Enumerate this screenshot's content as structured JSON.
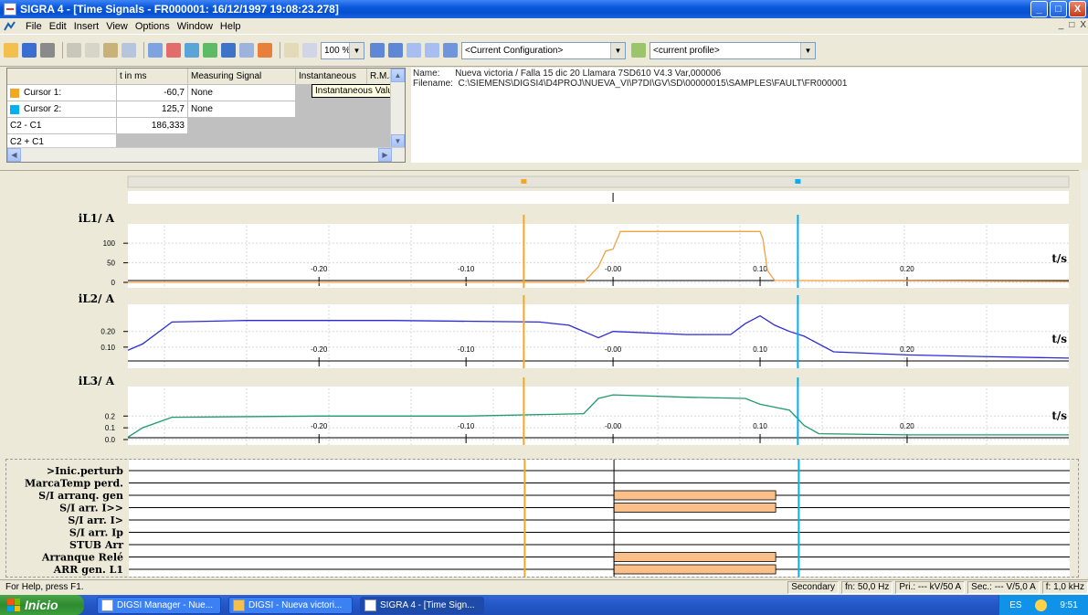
{
  "window": {
    "title": "SIGRA 4 - [Time Signals - FR000001: 16/12/1997 19:08:23.278]",
    "controls": [
      "_",
      "□",
      "X"
    ]
  },
  "menu": [
    "File",
    "Edit",
    "Insert",
    "View",
    "Options",
    "Window",
    "Help"
  ],
  "toolbar": {
    "zoom_value": "100 %",
    "configuration": "<Current Configuration>",
    "profile": "<current profile>"
  },
  "cursor_table": {
    "headers": [
      "",
      "t in ms",
      "Measuring Signal",
      "Instantaneous",
      "R.M.S"
    ],
    "rows": [
      {
        "label": "Cursor 1:",
        "swatch": "#f5a623",
        "t": "-60,7",
        "signal": "None"
      },
      {
        "label": "Cursor 2:",
        "swatch": "#00b0f0",
        "t": "125,7",
        "signal": "None"
      },
      {
        "label": "C2 - C1",
        "t": "186,333",
        "signal": ""
      },
      {
        "label": "C2 + C1",
        "t": "",
        "signal": ""
      }
    ],
    "tooltip": "Instantaneous Value"
  },
  "file_info": {
    "name_label": "Name:",
    "name_value": "Nueva victoria / Falla 15 dic 20  Llamara  7SD610 V4.3 Var,000006",
    "filename_label": "Filename:",
    "filename_value": "C:\\SIEMENS\\DIGSI4\\D4PROJ\\NUEVA_VI\\P7DI\\GV\\SD\\00000015\\SAMPLES\\FAULT\\FR000001"
  },
  "chart_data": [
    {
      "type": "line",
      "title": "iL1/ A",
      "color": "#f5a142",
      "x_ticks": [
        "-0.20",
        "-0.10",
        "-0.00",
        "0.10",
        "0.20"
      ],
      "y_ticks": [
        "100",
        "50",
        "0"
      ],
      "xlabel": "t/s",
      "ylim": [
        0,
        140
      ],
      "xlim": [
        -0.33,
        0.31
      ],
      "series": [
        {
          "x": [
            -0.33,
            -0.02,
            -0.01,
            -0.005,
            0.0,
            0.005,
            0.01,
            0.1,
            0.102,
            0.105,
            0.11,
            0.31
          ],
          "y": [
            0,
            0,
            40,
            80,
            85,
            130,
            130,
            130,
            110,
            30,
            5,
            2
          ]
        }
      ]
    },
    {
      "type": "line",
      "title": "iL2/ A",
      "color": "#2b2bd6",
      "x_ticks": [
        "-0.20",
        "-0.10",
        "-0.00",
        "0.10",
        "0.20"
      ],
      "y_ticks": [
        "0.20",
        "0.10"
      ],
      "xlabel": "t/s",
      "ylim": [
        0.0,
        0.35
      ],
      "xlim": [
        -0.33,
        0.31
      ],
      "series": [
        {
          "x": [
            -0.33,
            -0.32,
            -0.3,
            -0.25,
            -0.15,
            -0.05,
            -0.03,
            -0.01,
            0.0,
            0.05,
            0.08,
            0.09,
            0.1,
            0.11,
            0.12,
            0.13,
            0.15,
            0.2,
            0.25,
            0.31
          ],
          "y": [
            0.08,
            0.12,
            0.26,
            0.27,
            0.27,
            0.26,
            0.24,
            0.16,
            0.2,
            0.18,
            0.18,
            0.25,
            0.3,
            0.24,
            0.2,
            0.17,
            0.07,
            0.05,
            0.04,
            0.03
          ]
        }
      ]
    },
    {
      "type": "line",
      "title": "iL3/ A",
      "color": "#1f9a6a",
      "x_ticks": [
        "-0.20",
        "-0.10",
        "-0.00",
        "0.10",
        "0.20"
      ],
      "y_ticks": [
        "0.2",
        "0.1",
        "0.0"
      ],
      "xlabel": "t/s",
      "ylim": [
        0.0,
        0.42
      ],
      "xlim": [
        -0.33,
        0.31
      ],
      "series": [
        {
          "x": [
            -0.33,
            -0.32,
            -0.3,
            -0.2,
            -0.1,
            -0.02,
            -0.01,
            0.0,
            0.05,
            0.09,
            0.1,
            0.12,
            0.13,
            0.14,
            0.2,
            0.31
          ],
          "y": [
            0.02,
            0.1,
            0.19,
            0.2,
            0.2,
            0.22,
            0.35,
            0.38,
            0.36,
            0.35,
            0.3,
            0.25,
            0.12,
            0.05,
            0.04,
            0.04
          ]
        }
      ]
    }
  ],
  "cursors": {
    "c1_t": -0.0607,
    "c2_t": 0.1257
  },
  "binary_signals": {
    "labels": [
      ">Inic.perturb",
      "MarcaTemp perd.",
      "S/I arranq. gen",
      "S/I arr. I>>",
      "S/I arr. I>",
      "S/I arr. Ip",
      "STUB Arr",
      "Arranque Relé",
      "ARR gen. L1"
    ],
    "active": [
      false,
      false,
      true,
      true,
      false,
      false,
      false,
      true,
      true
    ],
    "on_t": 0.0,
    "off_t": 0.11,
    "bar_color": "#fbc08a"
  },
  "status": {
    "help": "For Help, press F1.",
    "mode": "Secondary",
    "fn": "fn: 50,0 Hz",
    "pri": "Pri.: --- kV/50 A",
    "sec": "Sec.: --- V/5,0 A",
    "f": "f: 1,0 kHz"
  },
  "taskbar": {
    "start": "Inicio",
    "tasks": [
      "DIGSI Manager - Nue...",
      "DIGSI - Nueva victori...",
      "SIGRA 4 - [Time Sign..."
    ],
    "lang": "ES",
    "clock": "9:51"
  }
}
